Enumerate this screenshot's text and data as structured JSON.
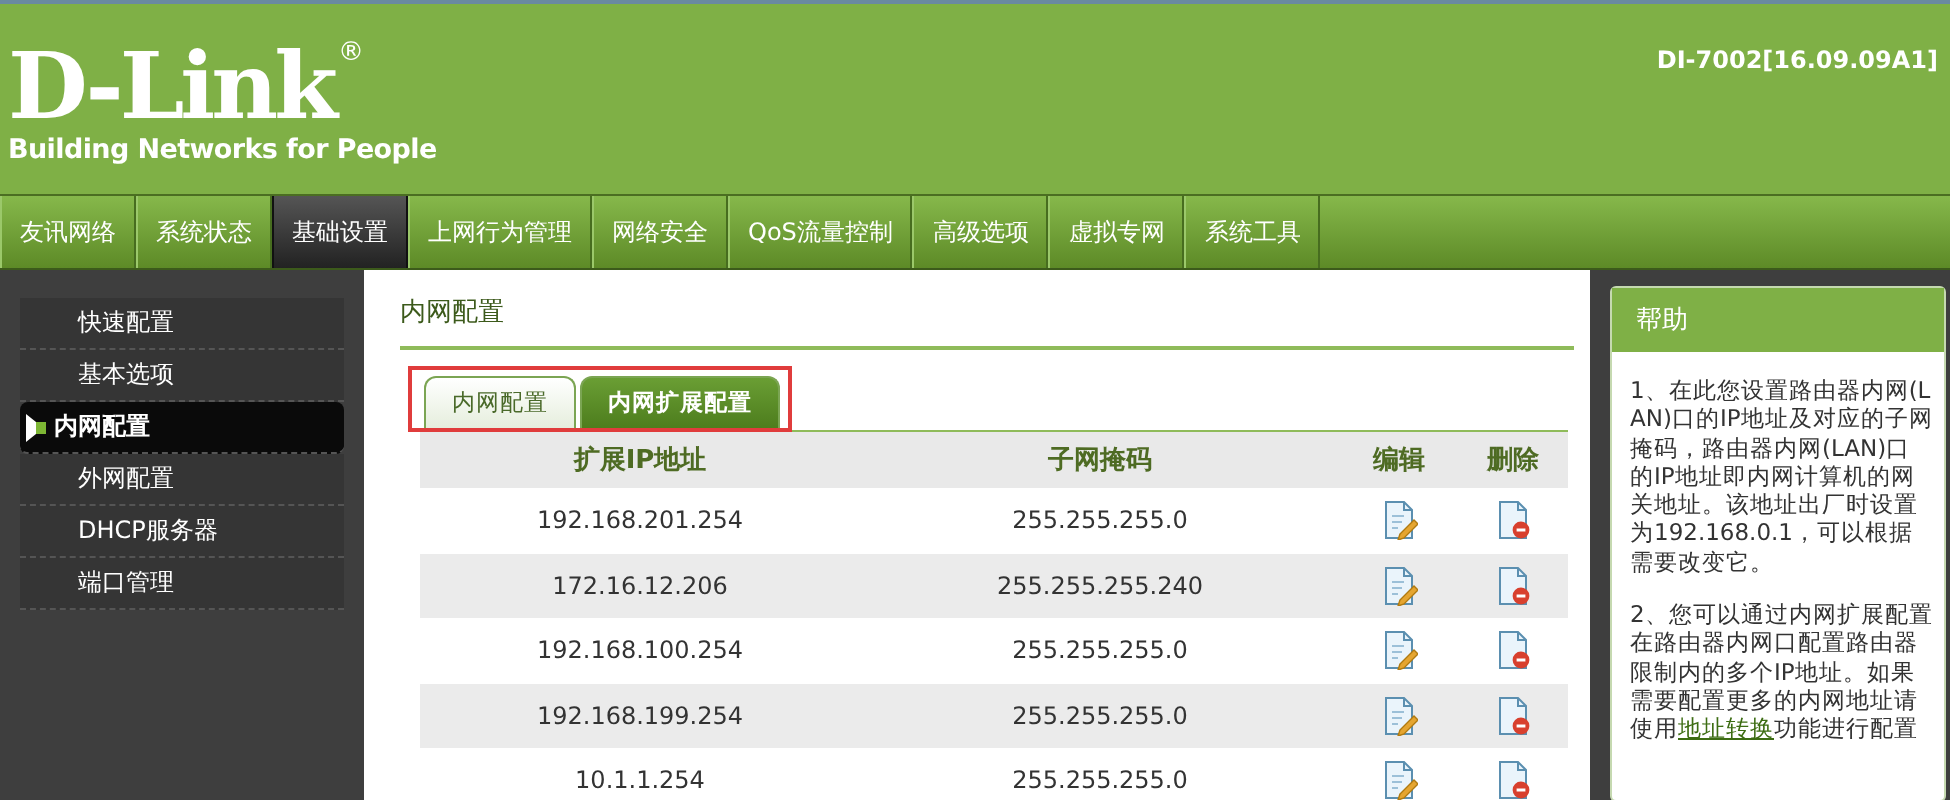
{
  "header": {
    "logo": "D-Link",
    "registered": "®",
    "tagline": "Building Networks for People",
    "version": "DI-7002[16.09.09A1]"
  },
  "nav": [
    {
      "label": "友讯网络",
      "selected": false
    },
    {
      "label": "系统状态",
      "selected": false
    },
    {
      "label": "基础设置",
      "selected": true
    },
    {
      "label": "上网行为管理",
      "selected": false
    },
    {
      "label": "网络安全",
      "selected": false
    },
    {
      "label": "QoS流量控制",
      "selected": false
    },
    {
      "label": "高级选项",
      "selected": false
    },
    {
      "label": "虚拟专网",
      "selected": false
    },
    {
      "label": "系统工具",
      "selected": false
    }
  ],
  "sidebar": {
    "items": [
      {
        "label": "快速配置",
        "selected": false
      },
      {
        "label": "基本选项",
        "selected": false
      },
      {
        "label": "内网配置",
        "selected": true
      },
      {
        "label": "外网配置",
        "selected": false
      },
      {
        "label": "DHCP服务器",
        "selected": false
      },
      {
        "label": "端口管理",
        "selected": false
      }
    ]
  },
  "content": {
    "title": "内网配置",
    "tabs": [
      {
        "label": "内网配置",
        "selected": false
      },
      {
        "label": "内网扩展配置",
        "selected": true
      }
    ],
    "table": {
      "columns": [
        "扩展IP地址",
        "子网掩码",
        "编辑",
        "删除"
      ],
      "rows": [
        {
          "ip": "192.168.201.254",
          "mask": "255.255.255.0"
        },
        {
          "ip": "172.16.12.206",
          "mask": "255.255.255.240"
        },
        {
          "ip": "192.168.100.254",
          "mask": "255.255.255.0"
        },
        {
          "ip": "192.168.199.254",
          "mask": "255.255.255.0"
        },
        {
          "ip": "10.1.1.254",
          "mask": "255.255.255.0"
        }
      ]
    }
  },
  "help": {
    "title": "帮助",
    "paragraph_1": "1、在此您设置路由器内网(LAN)口的IP地址及对应的子网掩码，路由器内网(LAN)口的IP地址即内网计算机的网关地址。该地址出厂时设置为192.168.0.1，可以根据需要改变它。",
    "paragraph_2": {
      "before": "2、您可以通过内网扩展配置在路由器内网口配置路由器限制内的多个IP地址。如果需要配置更多的内网地址请使用",
      "link": "地址转换",
      "after": "功能进行配置"
    }
  }
}
